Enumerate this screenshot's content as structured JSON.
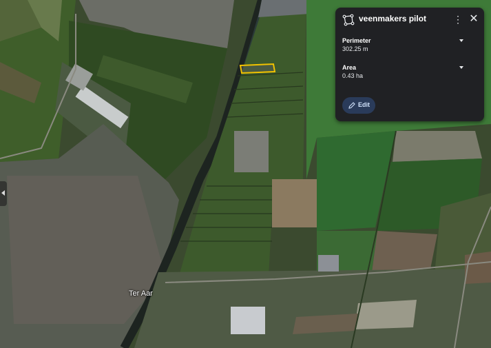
{
  "map": {
    "place_label": "Ter Aar",
    "highlight_color": "#f2c200"
  },
  "panel": {
    "title": "veenmakers pilot",
    "title_icon": "polygon-icon",
    "more_icon": "more-vert-icon",
    "close_icon": "close-icon",
    "perimeter": {
      "label": "Perimeter",
      "value": "302.25 m"
    },
    "area": {
      "label": "Area",
      "value": "0.43 ha"
    },
    "edit_label": "Edit"
  },
  "colors": {
    "panel_bg": "#202124",
    "edit_bg": "#2a3b5a",
    "edit_text": "#d2e3fc"
  }
}
